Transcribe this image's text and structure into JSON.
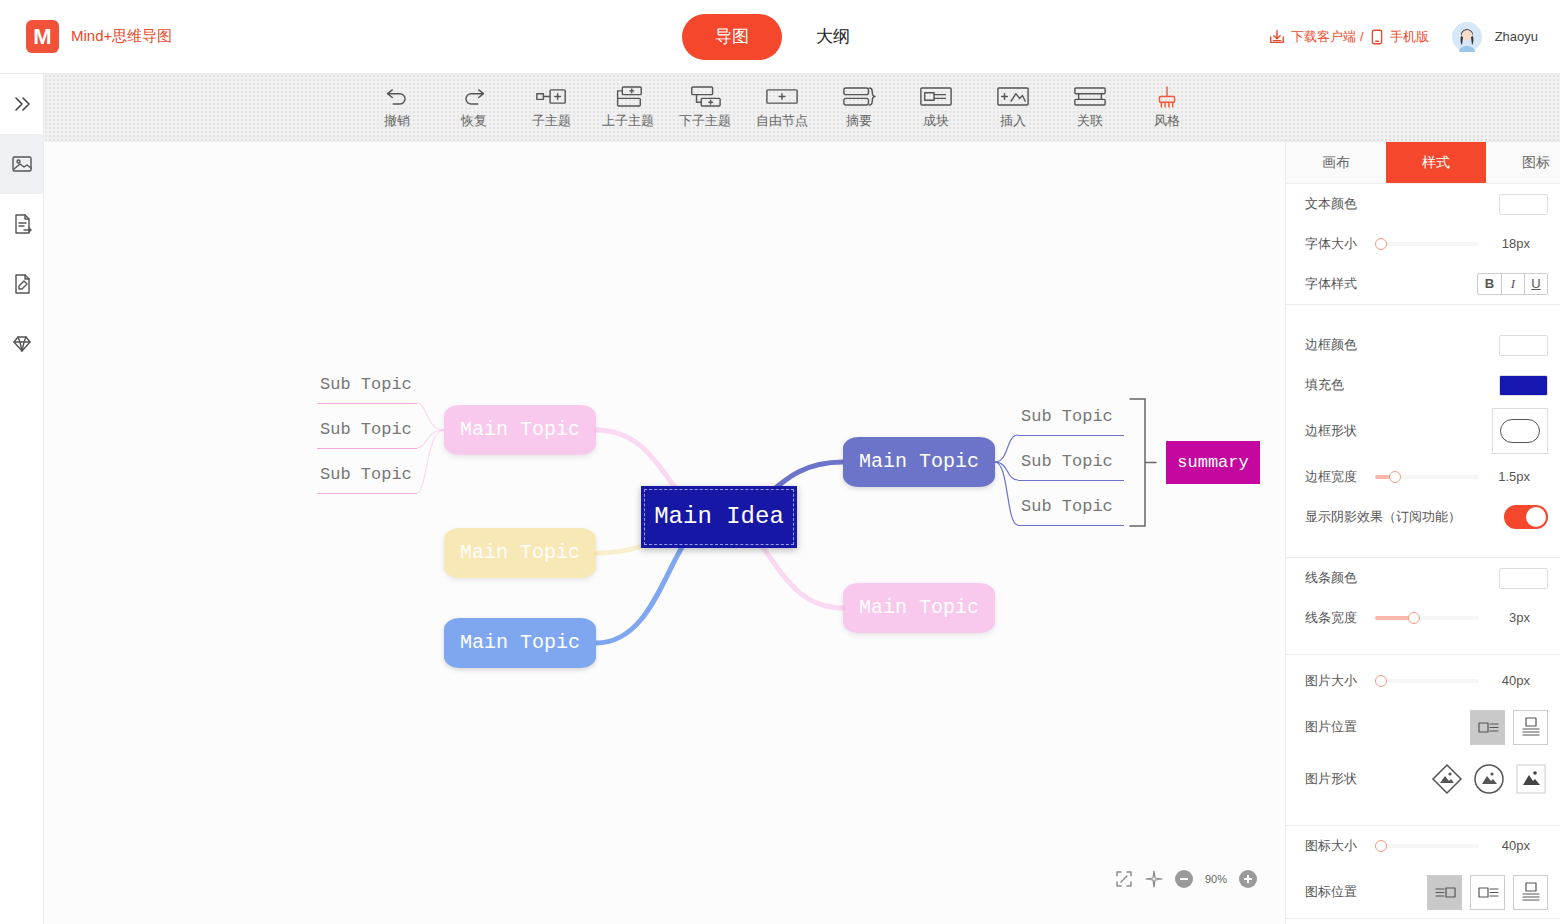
{
  "app": {
    "logo": "M",
    "name": "Mind+思维导图"
  },
  "view_tabs": [
    {
      "label": "导图",
      "selected": true
    },
    {
      "label": "大纲",
      "selected": false
    }
  ],
  "header_links": {
    "download": "下载客户端 /",
    "mobile": "手机版"
  },
  "user": {
    "name": "Zhaoyu"
  },
  "sidebar": {
    "items": [
      {
        "selected": true
      },
      {
        "selected": false
      },
      {
        "selected": false
      },
      {
        "selected": false
      }
    ]
  },
  "toolbar": [
    {
      "label": "撤销"
    },
    {
      "label": "恢复"
    },
    {
      "label": "子主题"
    },
    {
      "label": "上子主题"
    },
    {
      "label": "下子主题"
    },
    {
      "label": "自由节点"
    },
    {
      "label": "摘要"
    },
    {
      "label": "成块"
    },
    {
      "label": "插入"
    },
    {
      "label": "关联"
    },
    {
      "label": "风格"
    }
  ],
  "mindmap": {
    "root": {
      "label": "Main Idea",
      "color": "#1717a6",
      "selected": true
    },
    "topics": [
      {
        "label": "Main Topic",
        "color": "#f7a8e3",
        "dimmed": true,
        "subtopics": [
          {
            "label": "Sub Topic"
          },
          {
            "label": "Sub Topic"
          },
          {
            "label": "Sub Topic"
          }
        ]
      },
      {
        "label": "Main Topic",
        "color": "#f6dc86",
        "dimmed": true,
        "subtopics": []
      },
      {
        "label": "Main Topic",
        "color": "#7fa7f0",
        "dimmed": false,
        "subtopics": []
      },
      {
        "label": "Main Topic",
        "color": "#6b74c9",
        "dimmed": false,
        "subtopics": [
          {
            "label": "Sub Topic"
          },
          {
            "label": "Sub Topic"
          },
          {
            "label": "Sub Topic"
          }
        ],
        "summary": {
          "label": "summary",
          "color": "#c4079e"
        }
      },
      {
        "label": "Main Topic",
        "color": "#f7a8e3",
        "dimmed": true,
        "subtopics": []
      }
    ]
  },
  "zoom": {
    "reading": "90%"
  },
  "panel_tabs": [
    {
      "label": "画布",
      "selected": false
    },
    {
      "label": "样式",
      "selected": true
    },
    {
      "label": "图标",
      "selected": false
    }
  ],
  "style_groups": [
    {
      "rows": [
        {
          "label": "文本颜色",
          "kind": "color",
          "color": "#ffffff"
        },
        {
          "label": "字体大小",
          "kind": "slider",
          "level": 0.0,
          "reading": "18px"
        },
        {
          "label": "字体样式",
          "kind": "buttons",
          "buttons": [
            {
              "label": "B",
              "on": false
            },
            {
              "label": "I",
              "on": false
            },
            {
              "label": "U",
              "on": false
            }
          ]
        }
      ]
    },
    {
      "rows": [
        {
          "label": "边框颜色",
          "kind": "color",
          "color": "#ffffff"
        },
        {
          "label": "填充色",
          "kind": "color",
          "color": "#1616b0"
        },
        {
          "label": "边框形状",
          "kind": "shape"
        },
        {
          "label": "边框宽度",
          "kind": "slider",
          "level": 0.15,
          "reading": "1.5px"
        },
        {
          "label": "显示阴影效果（订阅功能）",
          "kind": "toggle",
          "on": true
        }
      ]
    },
    {
      "rows": [
        {
          "label": "线条颜色",
          "kind": "color",
          "color": "#ffffff"
        },
        {
          "label": "线条宽度",
          "kind": "slider",
          "level": 0.36,
          "reading": "3px"
        }
      ]
    },
    {
      "rows": [
        {
          "label": "图片大小",
          "kind": "slider",
          "level": 0.0,
          "reading": "40px"
        },
        {
          "label": "图片位置",
          "kind": "position",
          "options": [
            {
              "selected": true
            },
            {
              "selected": false
            }
          ]
        },
        {
          "label": "图片形状",
          "kind": "imageshape",
          "options": [
            {
              "selected": false
            },
            {
              "selected": false
            },
            {
              "selected": false
            }
          ]
        }
      ]
    },
    {
      "rows": [
        {
          "label": "图标大小",
          "kind": "slider",
          "level": 0.0,
          "reading": "40px"
        },
        {
          "label": "图标位置",
          "kind": "position",
          "options": [
            {
              "selected": true
            },
            {
              "selected": false
            },
            {
              "selected": false
            }
          ]
        }
      ]
    }
  ]
}
